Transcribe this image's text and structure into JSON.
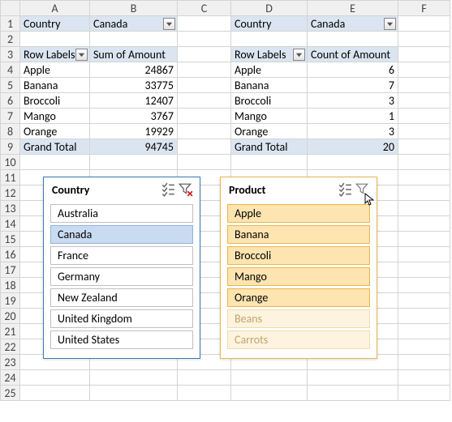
{
  "columns": [
    "A",
    "B",
    "C",
    "D",
    "E",
    "F"
  ],
  "row_count": 25,
  "pivot_left": {
    "filter_field": "Country",
    "filter_value": "Canada",
    "row_label_header": "Row Labels",
    "value_header": "Sum of Amount",
    "rows": [
      {
        "label": "Apple",
        "value": "24867"
      },
      {
        "label": "Banana",
        "value": "33775"
      },
      {
        "label": "Broccoli",
        "value": "12407"
      },
      {
        "label": "Mango",
        "value": "3767"
      },
      {
        "label": "Orange",
        "value": "19929"
      }
    ],
    "grand_label": "Grand Total",
    "grand_value": "94745"
  },
  "pivot_right": {
    "filter_field": "Country",
    "filter_value": "Canada",
    "row_label_header": "Row Labels",
    "value_header": "Count of Amount",
    "rows": [
      {
        "label": "Apple",
        "value": "6"
      },
      {
        "label": "Banana",
        "value": "7"
      },
      {
        "label": "Broccoli",
        "value": "3"
      },
      {
        "label": "Mango",
        "value": "1"
      },
      {
        "label": "Orange",
        "value": "3"
      }
    ],
    "grand_label": "Grand Total",
    "grand_value": "20"
  },
  "slicer_country": {
    "title": "Country",
    "items": [
      {
        "label": "Australia",
        "selected": false
      },
      {
        "label": "Canada",
        "selected": true
      },
      {
        "label": "France",
        "selected": false
      },
      {
        "label": "Germany",
        "selected": false
      },
      {
        "label": "New Zealand",
        "selected": false
      },
      {
        "label": "United Kingdom",
        "selected": false
      },
      {
        "label": "United States",
        "selected": false
      }
    ]
  },
  "slicer_product": {
    "title": "Product",
    "items": [
      {
        "label": "Apple",
        "nodata": false
      },
      {
        "label": "Banana",
        "nodata": false
      },
      {
        "label": "Broccoli",
        "nodata": false
      },
      {
        "label": "Mango",
        "nodata": false
      },
      {
        "label": "Orange",
        "nodata": false
      },
      {
        "label": "Beans",
        "nodata": true
      },
      {
        "label": "Carrots",
        "nodata": true
      }
    ]
  },
  "chart_data": [
    {
      "type": "table",
      "title": "Sum of Amount by Row Labels (Country = Canada)",
      "categories": [
        "Apple",
        "Banana",
        "Broccoli",
        "Mango",
        "Orange"
      ],
      "values": [
        24867,
        33775,
        12407,
        3767,
        19929
      ],
      "total": 94745
    },
    {
      "type": "table",
      "title": "Count of Amount by Row Labels (Country = Canada)",
      "categories": [
        "Apple",
        "Banana",
        "Broccoli",
        "Mango",
        "Orange"
      ],
      "values": [
        6,
        7,
        3,
        1,
        3
      ],
      "total": 20
    }
  ]
}
